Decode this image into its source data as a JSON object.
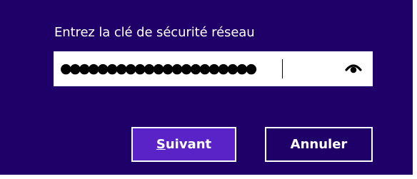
{
  "dialog": {
    "prompt": "Entrez la clé de sécurité réseau",
    "password_field": {
      "masked_value": "●●●●●●●●●●●●●●●●●●●●●"
    },
    "reveal_icon": "eye-reveal-icon",
    "buttons": {
      "next_accel": "S",
      "next_rest": "uivant",
      "cancel": "Annuler"
    },
    "colors": {
      "background": "#1f0068",
      "primary_button": "#5a23c8",
      "field": "#ffffff",
      "text": "#ffffff"
    }
  }
}
